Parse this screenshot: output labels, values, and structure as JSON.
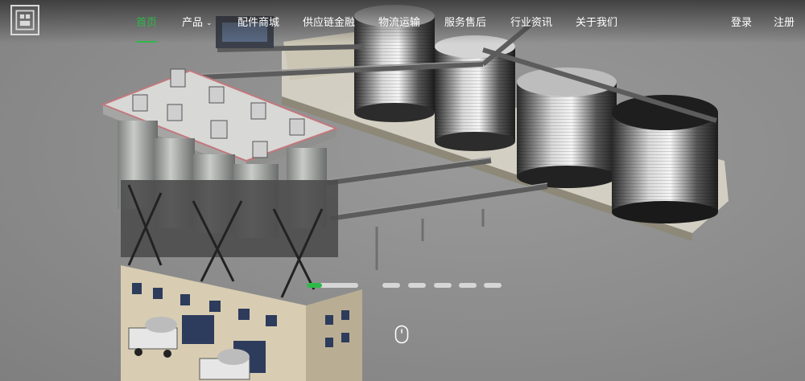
{
  "brand": {
    "logo": "logo-icon"
  },
  "nav": {
    "items": [
      {
        "label": "首页",
        "active": true
      },
      {
        "label": "产品",
        "has_dropdown": true
      },
      {
        "label": "配件商城"
      },
      {
        "label": "供应链金融"
      },
      {
        "label": "物流运输"
      },
      {
        "label": "服务售后"
      },
      {
        "label": "行业资讯"
      },
      {
        "label": "关于我们"
      }
    ],
    "accent": "#2fb84a"
  },
  "auth": {
    "login": "登录",
    "register": "注册"
  },
  "carousel": {
    "slide_count": 7,
    "active_index": 0,
    "active_progress": 0.3,
    "scroll_hint": "mouse-icon"
  }
}
